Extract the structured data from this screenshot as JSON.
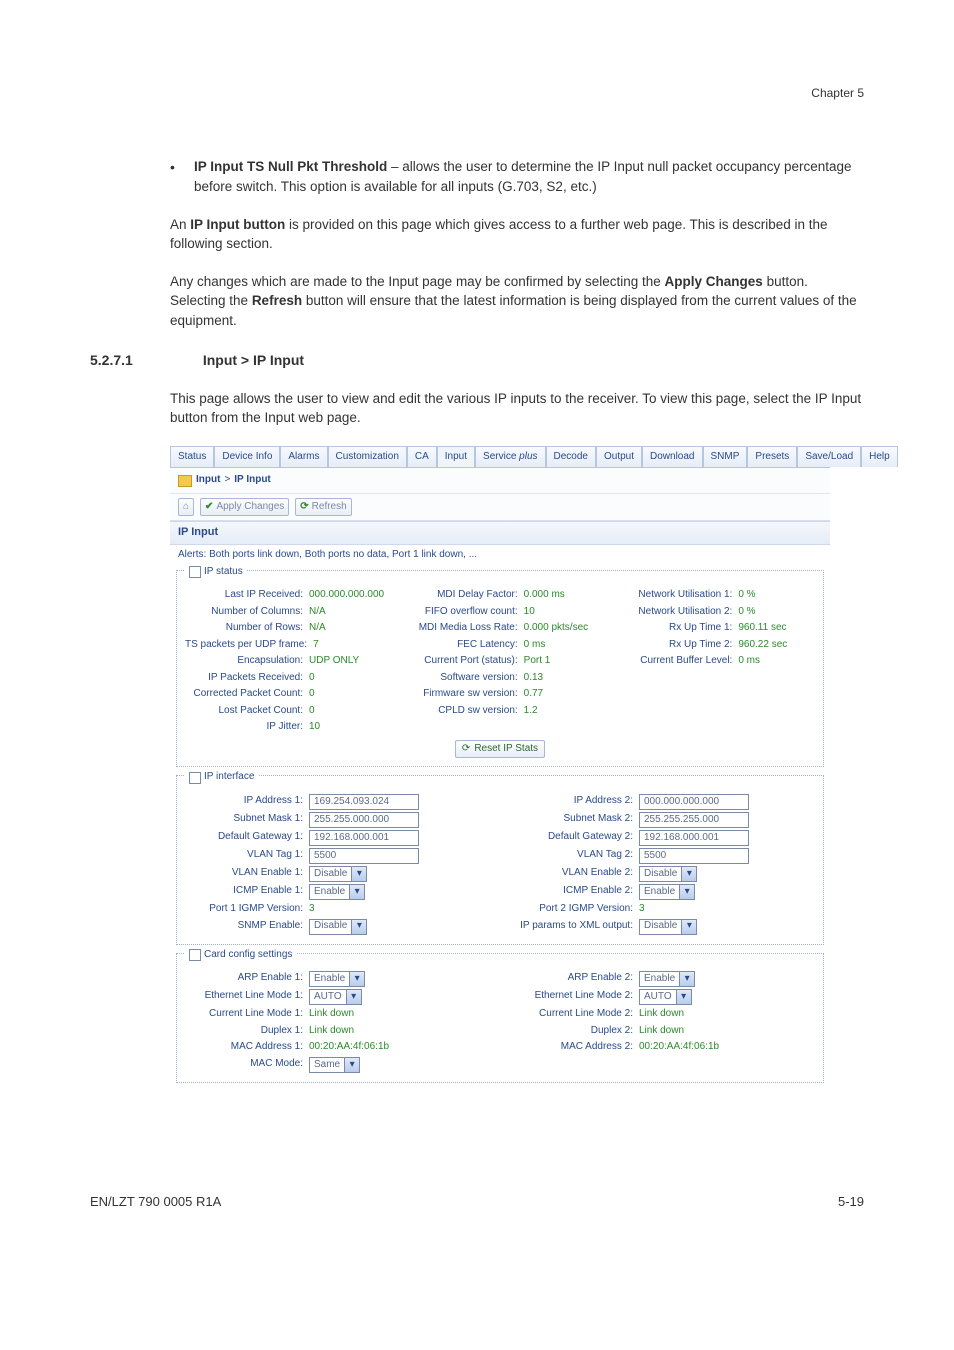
{
  "header": {
    "chapter": "Chapter 5"
  },
  "body": {
    "bullet_label": "IP Input TS Null Pkt Threshold",
    "bullet_rest": " – allows the user to determine the IP Input null packet occupancy percentage before switch. This option is available for all inputs (G.703, S2, etc.)",
    "para1a": "An ",
    "para1b": "IP Input button",
    "para1c": " is provided on this page which gives access to a further web page. This is described in the following section.",
    "para2a": "Any changes which are made to the Input page may be confirmed by selecting the ",
    "para2b": "Apply Changes",
    "para2c": " button. Selecting the ",
    "para2d": "Refresh",
    "para2e": " button will ensure that the latest information is being displayed from the current values of the equipment."
  },
  "sec": {
    "num": "5.2.7.1",
    "title": "Input > IP Input"
  },
  "sec_para": "This page allows the user to view and edit the various IP inputs to the receiver. To view this page, select the IP Input button from the Input web page.",
  "tabs": [
    "Status",
    "Device Info",
    "Alarms",
    "Customization",
    "CA",
    "Input",
    "Service plus",
    "Decode",
    "Output",
    "Download",
    "SNMP",
    "Presets",
    "Save/Load",
    "Help"
  ],
  "breadcrumb": {
    "a": "Input",
    "sep": ">",
    "b": "IP Input"
  },
  "btns": {
    "apply": "Apply Changes",
    "refresh": "Refresh"
  },
  "sectitle": "IP Input",
  "alerts": "Alerts:   Both ports link down, Both ports no data, Port 1 link down, ...",
  "ipstatus": {
    "legend": "IP status",
    "reset": "Reset IP Stats",
    "c1": [
      {
        "k": "Last IP Received:",
        "v": "000.000.000.000"
      },
      {
        "k": "Number of Columns:",
        "v": "N/A"
      },
      {
        "k": "Number of Rows:",
        "v": "N/A"
      },
      {
        "k": "TS packets per UDP frame:",
        "v": "7"
      },
      {
        "k": "Encapsulation:",
        "v": "UDP ONLY"
      },
      {
        "k": "IP Packets Received:",
        "v": "0"
      },
      {
        "k": "Corrected Packet Count:",
        "v": "0"
      },
      {
        "k": "Lost Packet Count:",
        "v": "0"
      },
      {
        "k": "IP Jitter:",
        "v": "10"
      }
    ],
    "c2": [
      {
        "k": "MDI Delay Factor:",
        "v": "0.000 ms"
      },
      {
        "k": "FIFO overflow count:",
        "v": "10"
      },
      {
        "k": "MDI Media Loss Rate:",
        "v": "0.000 pkts/sec"
      },
      {
        "k": "FEC Latency:",
        "v": "0 ms"
      },
      {
        "k": "Current Port (status):",
        "v": "Port 1"
      },
      {
        "k": "Software version:",
        "v": "0.13"
      },
      {
        "k": "Firmware sw version:",
        "v": "0.77"
      },
      {
        "k": "CPLD sw version:",
        "v": "1.2"
      }
    ],
    "c3": [
      {
        "k": "Network Utilisation 1:",
        "v": "0 %"
      },
      {
        "k": "Network Utilisation 2:",
        "v": "0 %"
      },
      {
        "k": "Rx Up Time 1:",
        "v": "960.11 sec"
      },
      {
        "k": "Rx Up Time 2:",
        "v": "960.22 sec"
      },
      {
        "k": "Current Buffer Level:",
        "v": "0 ms"
      }
    ]
  },
  "ipif": {
    "legend": "IP interface",
    "c1": [
      {
        "k": "IP Address 1:",
        "type": "input",
        "v": "169.254.093.024"
      },
      {
        "k": "Subnet Mask 1:",
        "type": "input",
        "v": "255.255.000.000"
      },
      {
        "k": "Default Gateway 1:",
        "type": "input",
        "v": "192.168.000.001"
      },
      {
        "k": "VLAN Tag 1:",
        "type": "input",
        "v": "5500"
      },
      {
        "k": "VLAN Enable 1:",
        "type": "select",
        "v": "Disable"
      },
      {
        "k": "ICMP Enable 1:",
        "type": "select",
        "v": "Enable"
      },
      {
        "k": "Port 1 IGMP Version:",
        "type": "text",
        "v": "3"
      },
      {
        "k": "SNMP Enable:",
        "type": "select",
        "v": "Disable"
      }
    ],
    "c2": [
      {
        "k": "IP Address 2:",
        "type": "input",
        "v": "000.000.000.000"
      },
      {
        "k": "Subnet Mask 2:",
        "type": "input",
        "v": "255.255.255.000"
      },
      {
        "k": "Default Gateway 2:",
        "type": "input",
        "v": "192.168.000.001"
      },
      {
        "k": "VLAN Tag 2:",
        "type": "input",
        "v": "5500"
      },
      {
        "k": "VLAN Enable 2:",
        "type": "select",
        "v": "Disable"
      },
      {
        "k": "ICMP Enable 2:",
        "type": "select",
        "v": "Enable"
      },
      {
        "k": "Port 2 IGMP Version:",
        "type": "text",
        "v": "3"
      },
      {
        "k": "IP params to XML output:",
        "type": "select",
        "v": "Disable"
      }
    ]
  },
  "card": {
    "legend": "Card config settings",
    "c1": [
      {
        "k": "ARP Enable 1:",
        "type": "select",
        "v": "Enable"
      },
      {
        "k": "Ethernet Line Mode 1:",
        "type": "select",
        "v": "AUTO"
      },
      {
        "k": "Current Line Mode 1:",
        "type": "text",
        "v": "Link down"
      },
      {
        "k": "Duplex 1:",
        "type": "text",
        "v": "Link down"
      },
      {
        "k": "MAC Address 1:",
        "type": "text",
        "v": "00:20:AA:4f:06:1b"
      },
      {
        "k": "MAC Mode:",
        "type": "select",
        "v": "Same"
      }
    ],
    "c2": [
      {
        "k": "ARP Enable 2:",
        "type": "select",
        "v": "Enable"
      },
      {
        "k": "Ethernet Line Mode 2:",
        "type": "select",
        "v": "AUTO"
      },
      {
        "k": "Current Line Mode 2:",
        "type": "text",
        "v": "Link down"
      },
      {
        "k": "Duplex 2:",
        "type": "text",
        "v": "Link down"
      },
      {
        "k": "MAC Address 2:",
        "type": "text",
        "v": "00:20:AA:4f:06:1b"
      }
    ]
  },
  "footer": {
    "left": "EN/LZT 790 0005 R1A",
    "right": "5-19"
  }
}
